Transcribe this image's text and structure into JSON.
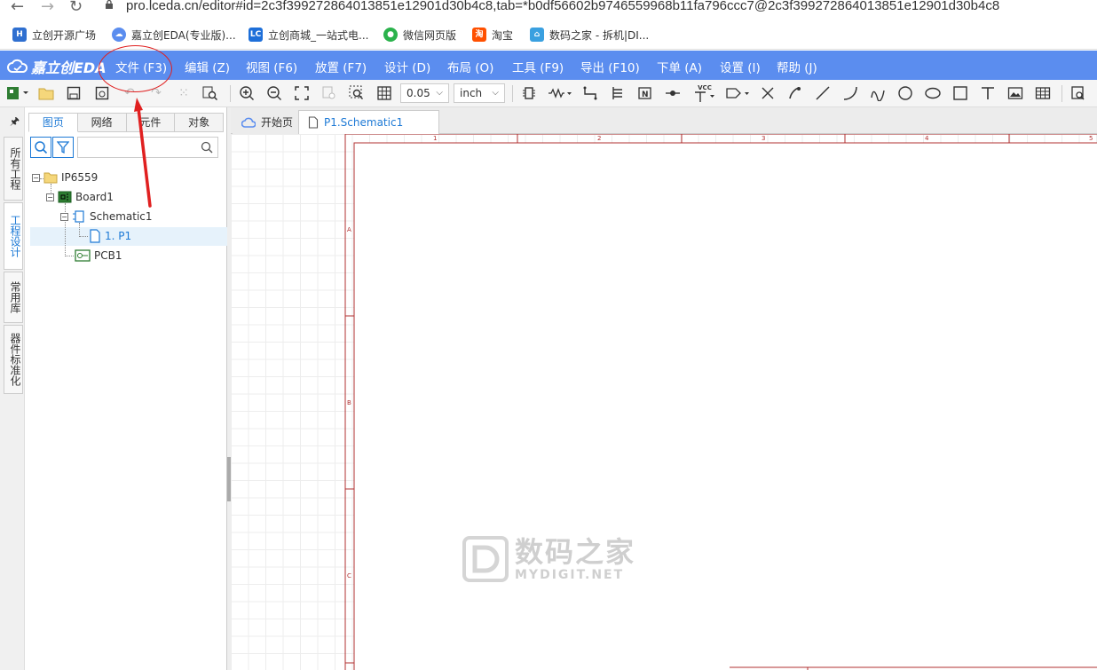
{
  "browser": {
    "url": "pro.lceda.cn/editor#id=2c3f399272864013851e12901d30b4c8,tab=*b0df56602b9746559968b11fa796ccc7@2c3f399272864013851e12901d30b4c8",
    "bookmarks": [
      {
        "label": "立创开源广场",
        "color": "#2f6fd0"
      },
      {
        "label": "嘉立创EDA(专业版)...",
        "color": "#5b8def"
      },
      {
        "label": "立创商城_一站式电...",
        "color": "#1e6fd9"
      },
      {
        "label": "微信网页版",
        "color": "#2bb24c"
      },
      {
        "label": "淘宝",
        "color": "#ff5000"
      },
      {
        "label": "数码之家 - 拆机|DI...",
        "color": "#3aa0e0"
      }
    ]
  },
  "app": {
    "logo": "嘉立创EDA",
    "menu": [
      "文件 (F3)",
      "编辑 (Z)",
      "视图 (F6)",
      "放置 (F7)",
      "设计 (D)",
      "布局 (O)",
      "工具 (F9)",
      "导出 (F10)",
      "下单 (A)",
      "设置 (I)",
      "帮助 (J)"
    ]
  },
  "toolbar": {
    "grid_value": "0.05",
    "unit_value": "inch",
    "vcc_label": "VCC"
  },
  "side_tabs": [
    "所有工程",
    "工程设计",
    "常用库",
    "器件标准化"
  ],
  "panel": {
    "tabs": [
      "图页",
      "网络",
      "元件",
      "对象"
    ],
    "search_placeholder": "",
    "tree": {
      "project": "IP6559",
      "board": "Board1",
      "schematic": "Schematic1",
      "page": "1. P1",
      "pcb": "PCB1"
    }
  },
  "doc_tabs": [
    "开始页",
    "P1.Schematic1"
  ],
  "sheet": {
    "col_labels": [
      "1",
      "2",
      "3",
      "4",
      "5"
    ],
    "row_labels": [
      "A",
      "B",
      "C"
    ]
  },
  "watermark": {
    "cn": "数码之家",
    "en": "MYDIGIT.NET"
  },
  "colors": {
    "menubar": "#5b8def",
    "accent": "#1e7ad6",
    "frame": "#b03030",
    "annotation": "#e02020"
  }
}
